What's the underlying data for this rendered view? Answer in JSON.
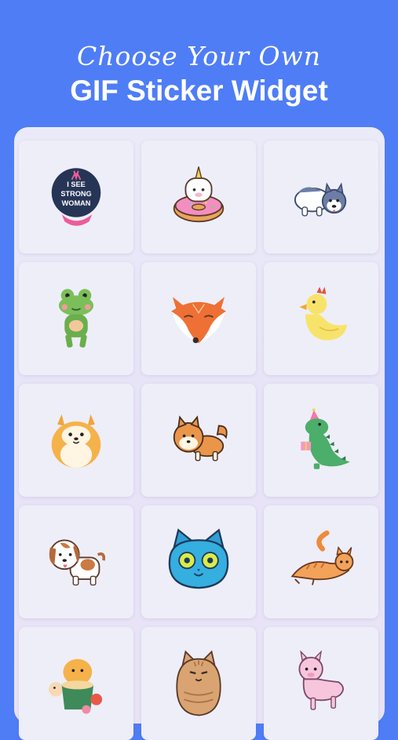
{
  "header": {
    "line1": "Choose Your Own",
    "line2": "GIF Sticker Widget"
  },
  "stickers": [
    {
      "icon": "i-see-strong-woman-badge-icon",
      "text_lines": [
        "I SEE",
        "STRONG",
        "WOMAN"
      ]
    },
    {
      "icon": "unicorn-donut-icon"
    },
    {
      "icon": "husky-dog-icon"
    },
    {
      "icon": "green-frog-icon"
    },
    {
      "icon": "fox-face-icon"
    },
    {
      "icon": "yellow-duck-icon"
    },
    {
      "icon": "pomeranian-dog-icon"
    },
    {
      "icon": "shiba-inu-dog-icon"
    },
    {
      "icon": "party-dinosaur-icon"
    },
    {
      "icon": "beagle-puppy-icon"
    },
    {
      "icon": "blue-cat-face-icon"
    },
    {
      "icon": "orange-tabby-cat-icon"
    },
    {
      "icon": "hamster-bowl-icon"
    },
    {
      "icon": "chubby-cat-icon"
    },
    {
      "icon": "pink-alpaca-icon"
    }
  ],
  "colors": {
    "background": "#4f7df6",
    "panel": "#e8e6f7",
    "tile": "#eeeef8"
  }
}
